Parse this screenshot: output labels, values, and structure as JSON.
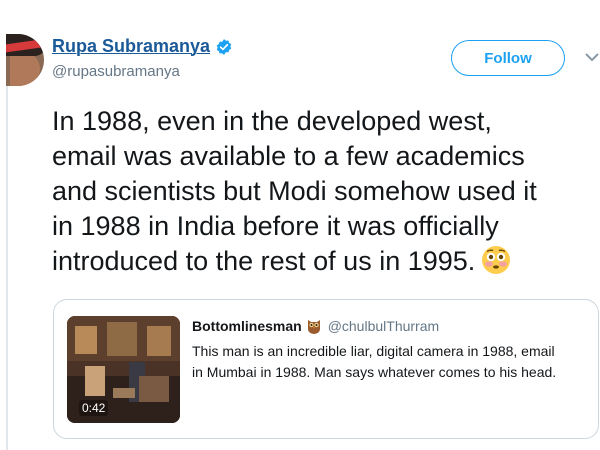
{
  "tweet": {
    "author_name": "Rupa Subramanya",
    "author_handle": "@rupasubramanya",
    "follow_label": "Follow",
    "text_lines": [
      "In 1988, even in the developed west,",
      "email was available to a few academics",
      "and scientists but Modi somehow used it",
      "in 1988 in India before it was officially",
      "introduced to the rest of us in 1995."
    ],
    "emoji": "flushed-face-icon"
  },
  "quoted_tweet": {
    "author_name": "Bottomlinesman",
    "author_handle": "@chulbulThurram",
    "text_lines": [
      "This man is an incredible liar, digital camera in 1988, email",
      "in Mumbai in 1988. Man says whatever comes to his head."
    ],
    "video_duration": "0:42"
  },
  "colors": {
    "name_link": "#1b5a98",
    "accent": "#1da1f2",
    "secondary_text": "#657786",
    "border": "#ccd6dd"
  }
}
